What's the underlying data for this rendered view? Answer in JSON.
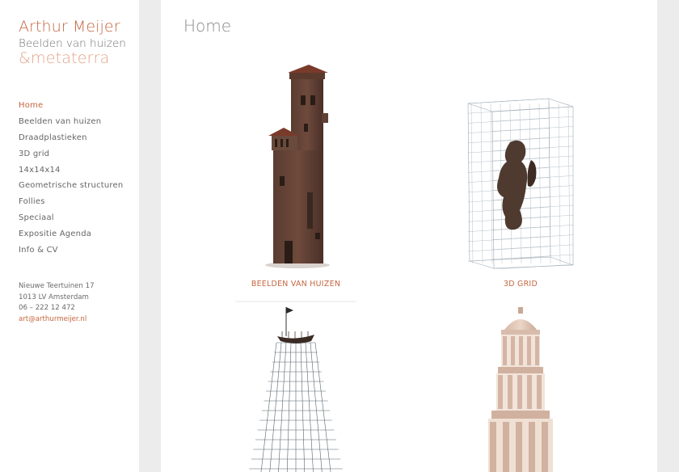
{
  "brand": {
    "name": "Arthur Meijer",
    "subtitle": "Beelden van huizen",
    "ampersand": "&",
    "meta": "metaterra"
  },
  "nav": {
    "items": [
      {
        "label": "Home",
        "active": true
      },
      {
        "label": "Beelden van huizen"
      },
      {
        "label": "Draadplastieken"
      },
      {
        "label": "3D grid"
      },
      {
        "label": "14x14x14"
      },
      {
        "label": "Geometrische structuren"
      },
      {
        "label": "Follies"
      },
      {
        "label": "Speciaal"
      },
      {
        "label": "Expositie Agenda"
      },
      {
        "label": "Info & CV"
      }
    ]
  },
  "contact": {
    "street": "Nieuwe Teertuinen 17",
    "city": "1013 LV Amsterdam",
    "phone": "06 – 222 12 472",
    "email": "art@arthurmeijer.nl"
  },
  "main": {
    "title": "Home",
    "tiles": [
      {
        "caption": "BEELDEN VAN HUIZEN",
        "image": "brick-tower-sculpture"
      },
      {
        "caption": "3D GRID",
        "image": "wire-grid-cube-sculpture"
      },
      {
        "caption": "",
        "image": "wire-tower-with-boat-sculpture"
      },
      {
        "caption": "",
        "image": "domed-temple-tower-sculpture"
      }
    ]
  },
  "colors": {
    "accent": "#c4653f",
    "accent_light": "#e3a488",
    "text": "#666666",
    "page_bg": "#ececec",
    "panel_bg": "#ffffff"
  }
}
